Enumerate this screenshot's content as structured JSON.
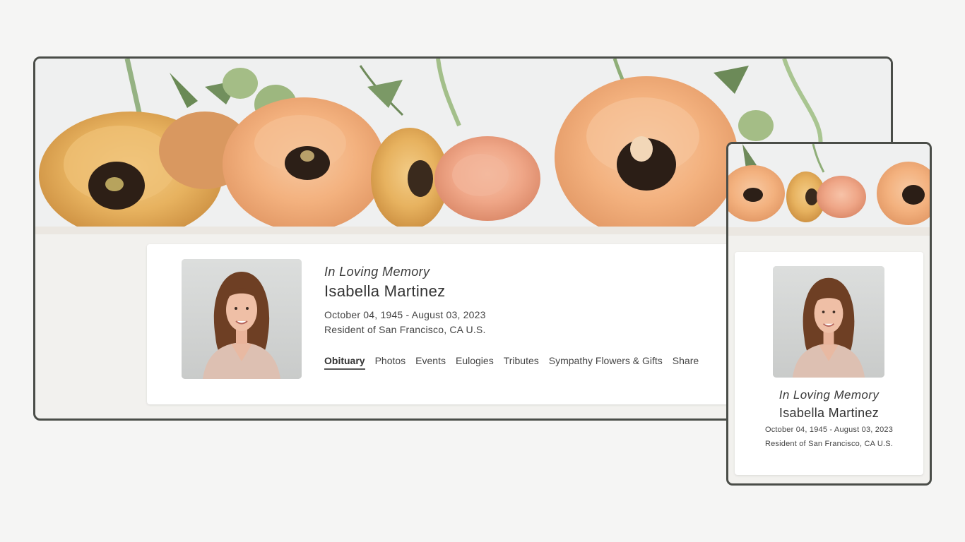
{
  "memorial": {
    "heading": "In Loving Memory",
    "name": "Isabella Martinez",
    "dates": "October 04, 1945 - August 03, 2023",
    "residence": "Resident of San Francisco, CA U.S."
  },
  "tabs": [
    {
      "label": "Obituary",
      "active": true
    },
    {
      "label": "Photos"
    },
    {
      "label": "Events"
    },
    {
      "label": "Eulogies"
    },
    {
      "label": "Tributes"
    },
    {
      "label": "Sympathy Flowers & Gifts"
    },
    {
      "label": "Share"
    }
  ],
  "colors": {
    "frame_border": "#4a4d48",
    "page_background": "#f5f5f4",
    "card_background": "#ffffff",
    "flower_peach": "#f3b27f",
    "flower_gold": "#e8b060",
    "flower_center": "#2c1f17"
  }
}
